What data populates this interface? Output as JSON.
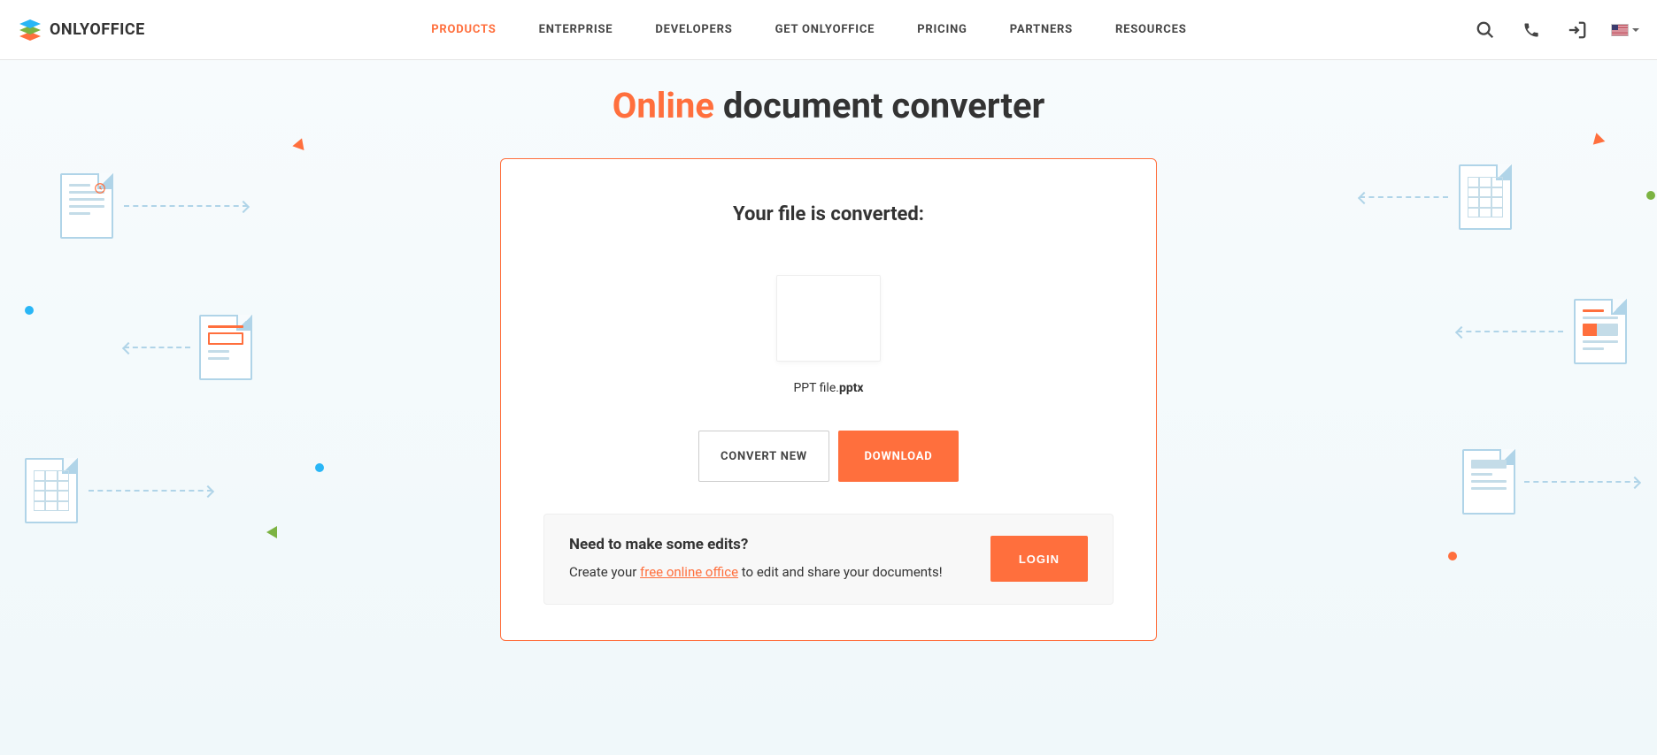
{
  "brand": "ONLYOFFICE",
  "nav": {
    "items": [
      {
        "label": "PRODUCTS",
        "active": true
      },
      {
        "label": "ENTERPRISE",
        "active": false
      },
      {
        "label": "DEVELOPERS",
        "active": false
      },
      {
        "label": "GET ONLYOFFICE",
        "active": false
      },
      {
        "label": "PRICING",
        "active": false
      },
      {
        "label": "PARTNERS",
        "active": false
      },
      {
        "label": "RESOURCES",
        "active": false
      }
    ]
  },
  "title": {
    "accent": "Online",
    "rest": " document converter"
  },
  "card": {
    "heading": "Your file is converted:",
    "file_basename": "PPT file.",
    "file_ext": "pptx",
    "convert_label": "CONVERT NEW",
    "download_label": "DOWNLOAD"
  },
  "cta": {
    "heading": "Need to make some edits?",
    "text_before": "Create your ",
    "link_text": "free online office",
    "text_after": " to edit and share your documents!",
    "login_label": "LOGIN"
  },
  "colors": {
    "accent": "#ff6f3d",
    "bg": "#f7fbfd"
  }
}
